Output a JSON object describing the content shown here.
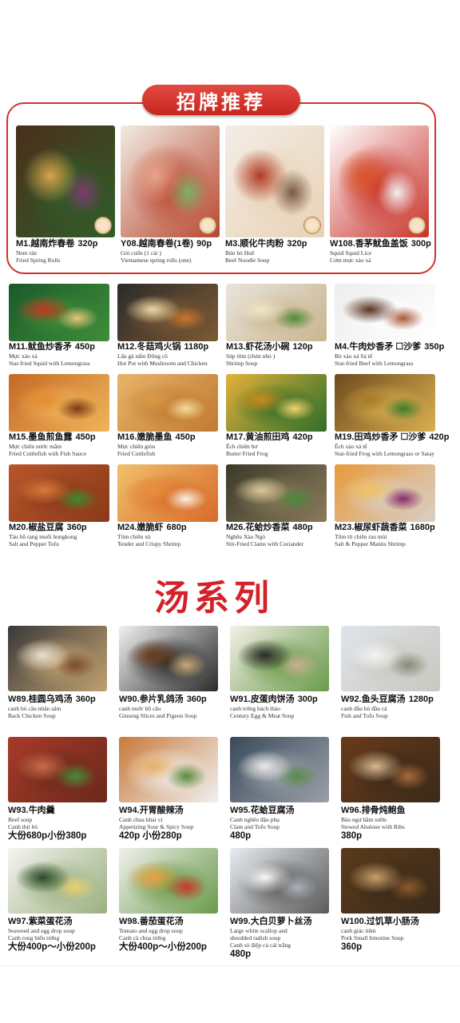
{
  "featured_banner": "招牌推荐",
  "soup_heading": "汤系列",
  "sections": [
    {
      "id": "featured",
      "items": [
        {
          "code": "M1.",
          "name": "越南炸春卷",
          "price": "320p",
          "lines": [
            "Nem rán",
            "Fried Spring Rolls"
          ],
          "extra": "",
          "colors": [
            "#4b2e1a",
            "#d9a24a",
            "#7a3b6e",
            "#2f5e2a"
          ]
        },
        {
          "code": "Y08.",
          "name": "越南春卷(1卷)",
          "price": "90p",
          "lines": [
            "Gỏi cuốn (1 cái )",
            "Vietnamese spring rolls (one)"
          ],
          "extra": "",
          "colors": [
            "#f1ece2",
            "#e7a38b",
            "#7fb069",
            "#b8462f"
          ]
        },
        {
          "code": "M3.",
          "name": "顺化牛肉粉",
          "price": "320p",
          "lines": [
            "Bún bò Huế",
            "Beef Noodle Soup"
          ],
          "extra": "",
          "colors": [
            "#f3ede6",
            "#b23a24",
            "#7a5a44",
            "#e9d2b6"
          ]
        },
        {
          "code": "W108.",
          "name": "香茅鱿鱼盖饭",
          "price": "300p",
          "lines": [
            "Squid Squid Lice",
            "Cơm mực xào xả"
          ],
          "extra": "",
          "colors": [
            "#ffffff",
            "#d8552a",
            "#f0f0f0",
            "#c8322a"
          ]
        }
      ]
    },
    {
      "id": "mains",
      "items": [
        {
          "code": "M11.",
          "name": "鱿鱼炒香矛",
          "price": "450p",
          "lines": [
            "Mực xào xả",
            "Star-fried Squid with Lemongrass"
          ],
          "extra": "",
          "colors": [
            "#1c5a2a",
            "#c2381f",
            "#e8c27a",
            "#3f8d3a"
          ]
        },
        {
          "code": "M12.",
          "name": "冬菇鸡火锅",
          "price": "1180p",
          "lines": [
            "Lẩu gà nấm Đông cô",
            "Hot Pot with Mushroom and Chicken"
          ],
          "extra": "",
          "colors": [
            "#2b2b2b",
            "#e9d7a6",
            "#c9732f",
            "#7d5a34"
          ]
        },
        {
          "code": "M13.",
          "name": "虾花汤小碗",
          "price": "120p",
          "lines": [
            "Súp tôm (chén nhỏ )",
            "Shrimp Soup"
          ],
          "extra": "",
          "colors": [
            "#e8e4dc",
            "#f0e6c8",
            "#4f8c3a",
            "#c9b58f"
          ]
        },
        {
          "code": "M4.",
          "name": "牛肉炒香矛 ☐沙爹",
          "price": "350p",
          "lines": [
            "Bò xào xả Sả tế",
            "Star-fried Beef with Lemongrass"
          ],
          "extra": "",
          "colors": [
            "#ededed",
            "#5a3222",
            "#a85a3a",
            "#ffffff"
          ]
        },
        {
          "code": "M15.",
          "name": "墨鱼煎鱼露",
          "price": "450p",
          "lines": [
            "Mực chiên nước mắm",
            "Fried Cuttlefish with Fish Sauce"
          ],
          "extra": "",
          "colors": [
            "#c46a25",
            "#e38b2f",
            "#7d3a14",
            "#f0b45a"
          ]
        },
        {
          "code": "M16.",
          "name": "嫩脆墨鱼",
          "price": "450p",
          "lines": [
            "Mực chiên giòn",
            "Fried Cuttlefish"
          ],
          "extra": "",
          "colors": [
            "#e8b46a",
            "#d89a48",
            "#f5d89a",
            "#c07a30"
          ]
        },
        {
          "code": "M17.",
          "name": "黄油煎田鸡",
          "price": "420p",
          "lines": [
            "Ếch chiên bơ",
            "Butter Fried Frog"
          ],
          "extra": "",
          "colors": [
            "#e3b13a",
            "#c98a1e",
            "#f3d36a",
            "#2f6e2a"
          ]
        },
        {
          "code": "M19.",
          "name": "田鸡炒香矛 ☐沙爹",
          "price": "420p",
          "lines": [
            "Ếch xào xả tế",
            "Star-fried Frog with Lemongrass or Satay"
          ],
          "extra": "",
          "colors": [
            "#6e4a1e",
            "#a87a2a",
            "#3f7d2a",
            "#d9b050"
          ]
        },
        {
          "code": "M20.",
          "name": "椒盐豆腐",
          "price": "360p",
          "lines": [
            "Tàu hũ rang muối hongkong",
            "Salt and Pepper Tofu"
          ],
          "extra": "",
          "colors": [
            "#b8552a",
            "#d97a3a",
            "#3f8a2a",
            "#8a3a1a"
          ]
        },
        {
          "code": "M24.",
          "name": "嫩脆虾",
          "price": "680p",
          "lines": [
            "Tôm chiên xù",
            "Tender and Crispy Shrimp"
          ],
          "extra": "",
          "colors": [
            "#f0c06a",
            "#e89040",
            "#f8f0e0",
            "#d86a2a"
          ]
        },
        {
          "code": "M26.",
          "name": "花蛤炒香菜",
          "price": "480p",
          "lines": [
            "Nghêu Xào Ngò",
            "Stir-Fried Clams with Coriander"
          ],
          "extra": "",
          "colors": [
            "#3a3a2a",
            "#d9c89a",
            "#4a8a3a",
            "#8a7a5a"
          ]
        },
        {
          "code": "M23.",
          "name": "椒尿虾蔬香菜",
          "price": "1680p",
          "lines": [
            "Tôm tít chiên rau mùi",
            "Salt & Pepper Mantis Shrimp"
          ],
          "extra": "",
          "colors": [
            "#e89a3a",
            "#f0c060",
            "#8a2a6a",
            "#d8d0c8"
          ]
        }
      ]
    },
    {
      "id": "soups",
      "items": [
        {
          "code": "W89.",
          "name": "桂圆乌鸡汤",
          "price": "360p",
          "lines": [
            "canh bò câu nhân sâm",
            "Back Chicken Soup"
          ],
          "extra": "",
          "colors": [
            "#3a3a3a",
            "#e8e0d0",
            "#7a4a2a",
            "#c0a070"
          ]
        },
        {
          "code": "W90.",
          "name": "参片乳鸽汤",
          "price": "360p",
          "lines": [
            "canh nuớc bồ câu",
            "Ginseng Slices and Pigeon Soup"
          ],
          "extra": "",
          "colors": [
            "#f0f0f0",
            "#6a3a1a",
            "#c8a878",
            "#2a2a2a"
          ]
        },
        {
          "code": "W91.",
          "name": "皮蛋肉饼汤",
          "price": "300p",
          "lines": [
            "canh trứng bách thảo",
            "Century Egg & Meat Soup"
          ],
          "extra": "",
          "colors": [
            "#f4f0e8",
            "#2a2a2a",
            "#c8b090",
            "#6a9a4a"
          ]
        },
        {
          "code": "W92.",
          "name": "鱼头豆腐汤",
          "price": "1280p",
          "lines": [
            "canh đầu hủ đầu cá",
            "Fish and Tofu Soup"
          ],
          "extra": "",
          "colors": [
            "#e0e4ea",
            "#f4f4f4",
            "#8a8a7a",
            "#c8c8c0"
          ]
        },
        {
          "code": "W93.",
          "name": "牛肉羹",
          "price": "",
          "lines": [
            "Beef soup",
            "Canh thịt bò"
          ],
          "extra": "大份680p小份380p",
          "colors": [
            "#a83a2a",
            "#c86a4a",
            "#4a8a3a",
            "#6a2a1a"
          ]
        },
        {
          "code": "W94.",
          "name": "开胃酸辣汤",
          "price": "",
          "lines": [
            "Canh chua khai vị",
            "Appetizing Sour & Spicy Soup"
          ],
          "extra": "420p 小份280p",
          "colors": [
            "#c87a3a",
            "#e8b06a",
            "#5a8a3a",
            "#f0f0f0"
          ]
        },
        {
          "code": "W95.",
          "name": "花蛤豆腐汤",
          "price": "",
          "lines": [
            "Canh nghêu đậu phụ",
            "Clam and Tofu Soup"
          ],
          "extra": "480p",
          "colors": [
            "#3a4a5a",
            "#e8e8e8",
            "#5a8a4a",
            "#9aa0a8"
          ]
        },
        {
          "code": "W96.",
          "name": "排骨炖鲍鱼",
          "price": "",
          "lines": [
            "Bào ngư hầm sườn",
            "Stewed Abalone with Ribs"
          ],
          "extra": "380p",
          "colors": [
            "#6a3a1a",
            "#d8b890",
            "#a86a3a",
            "#3a2a1a"
          ]
        },
        {
          "code": "W97.",
          "name": "紫菜蛋花汤",
          "price": "",
          "lines": [
            "Seaweed and egg drop soup",
            "Canh rong biển trứng"
          ],
          "extra": "大份400p～小份200p",
          "colors": [
            "#f4f4f0",
            "#2a4a2a",
            "#e8d070",
            "#9ab080"
          ]
        },
        {
          "code": "W98.",
          "name": "番茄蛋花汤",
          "price": "",
          "lines": [
            "Tomato and egg drop soup",
            "Canh cà chua trứng"
          ],
          "extra": "大份400p～小份200p",
          "colors": [
            "#f0f0ec",
            "#e8a040",
            "#c83a2a",
            "#6a9a4a"
          ]
        },
        {
          "code": "W99.",
          "name": "大白贝萝卜丝汤",
          "price": "",
          "lines": [
            "Large white scallop and",
            "shredded radish soup",
            "Canh sò điệp củ cải trắng"
          ],
          "extra": "480p",
          "colors": [
            "#e8ecf0",
            "#f8f8f8",
            "#a8b0b8",
            "#5a5a5a"
          ]
        },
        {
          "code": "W100.",
          "name": "过饥草小肠汤",
          "price": "",
          "lines": [
            "canh giác tiêm",
            "Pork Small Intestine Soup"
          ],
          "extra": "360p",
          "colors": [
            "#5a3a1a",
            "#c8a068",
            "#8a5a2a",
            "#3a2a1a"
          ]
        }
      ]
    }
  ]
}
